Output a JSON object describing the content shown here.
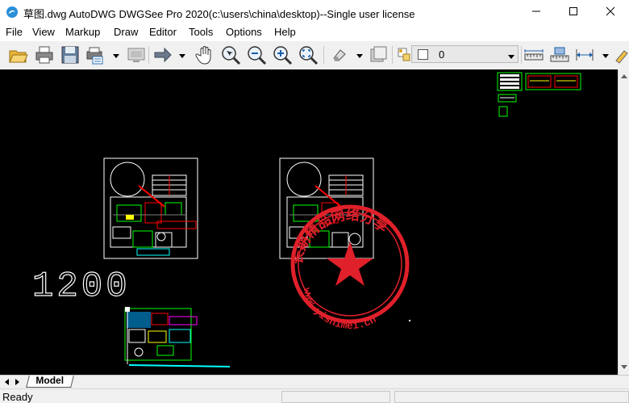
{
  "window": {
    "title": "草图.dwg AutoDWG DWGSee Pro 2020(c:\\users\\china\\desktop)--Single user license",
    "minimize_icon": "minimize-icon",
    "maximize_icon": "maximize-icon",
    "close_icon": "close-icon"
  },
  "menu": {
    "items": [
      "File",
      "View",
      "Markup",
      "Draw",
      "Editor",
      "Tools",
      "Options",
      "Help"
    ]
  },
  "toolbar": {
    "icons": [
      "open-folder-icon",
      "print-icon",
      "save-icon",
      "print-preview-icon",
      "display-icon",
      "arrow-right-icon",
      "pan-hand-icon",
      "zoom-realtime-icon",
      "zoom-out-icon",
      "zoom-in-icon",
      "zoom-extents-icon",
      "layer-icon",
      "square-icon",
      "layer-state-icon",
      "measure-icon",
      "measure-area-icon",
      "dimension-icon"
    ],
    "layer_value": "0"
  },
  "canvas": {
    "dimension_text": "1200",
    "stamp_text": "长期精品网络分享",
    "stamp_url": "www.yishimei.cn"
  },
  "tabs": {
    "model_label": "Model"
  },
  "status": {
    "ready_text": "Ready"
  },
  "colors": {
    "canvas_bg": "#000000",
    "stamp_red": "#e0202a",
    "cad_white": "#ffffff",
    "cad_green": "#00ff00",
    "cad_red": "#ff0000"
  }
}
